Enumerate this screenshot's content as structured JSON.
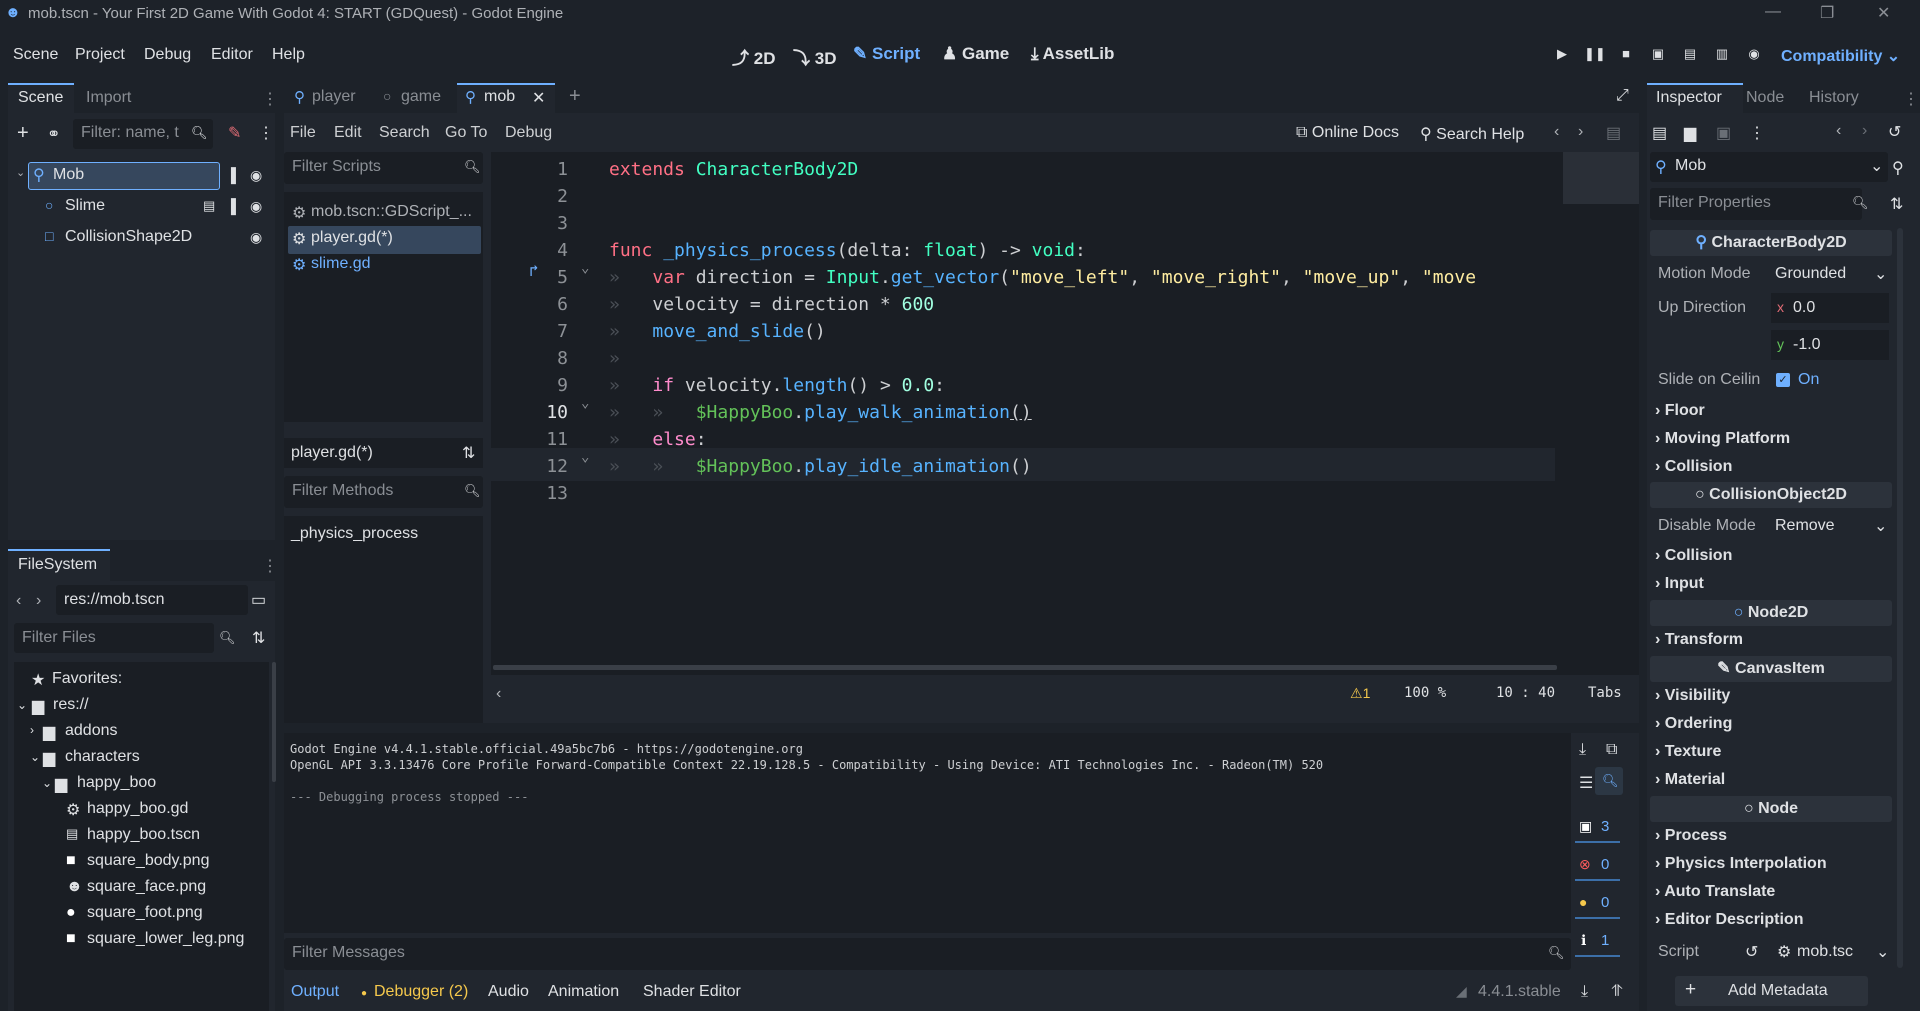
{
  "window": {
    "title": "mob.tscn - Your First 2D Game With Godot 4: START (GDQuest) - Godot Engine"
  },
  "menu": [
    "Scene",
    "Project",
    "Debug",
    "Editor",
    "Help"
  ],
  "workspaces": [
    {
      "label": "2D",
      "icon": "2d-icon"
    },
    {
      "label": "3D",
      "icon": "3d-icon"
    },
    {
      "label": "Script",
      "icon": "script-icon",
      "active": true
    },
    {
      "label": "Game",
      "icon": "game-icon"
    },
    {
      "label": "AssetLib",
      "icon": "assetlib-icon"
    }
  ],
  "renderer": "Compatibility",
  "scene_dock": {
    "tabs": [
      "Scene",
      "Import"
    ],
    "filter_placeholder": "Filter: name, t",
    "nodes": [
      "Mob",
      "Slime",
      "CollisionShape2D"
    ]
  },
  "filesystem": {
    "title": "FileSystem",
    "path": "res://mob.tscn",
    "filter_placeholder": "Filter Files",
    "items": [
      "Favorites:",
      "res://",
      "addons",
      "characters",
      "happy_boo",
      "happy_boo.gd",
      "happy_boo.tscn",
      "square_body.png",
      "square_face.png",
      "square_foot.png",
      "square_lower_leg.png"
    ]
  },
  "scene_tabs": [
    "player",
    "game",
    "mob"
  ],
  "script_menu": [
    "File",
    "Edit",
    "Search",
    "Go To",
    "Debug"
  ],
  "script_tools": {
    "online_docs": "Online Docs",
    "search_help": "Search Help"
  },
  "script_list": {
    "filter_placeholder": "Filter Scripts",
    "items": [
      "mob.tscn::GDScript_...",
      "player.gd(*)",
      "slime.gd"
    ],
    "current": "player.gd(*)",
    "methods_placeholder": "Filter Methods",
    "methods": [
      "_physics_process"
    ]
  },
  "code": {
    "line_numbers": [
      "1",
      "2",
      "3",
      "4",
      "5",
      "6",
      "7",
      "8",
      "9",
      "10",
      "11",
      "12",
      "13"
    ]
  },
  "status": {
    "warnings": "1",
    "zoom": "100 %",
    "line": "10",
    "col": "40",
    "indent": "Tabs"
  },
  "output": {
    "lines": [
      "Godot Engine v4.4.1.stable.official.49a5bc7b6 - https://godotengine.org",
      "OpenGL API 3.3.13476 Core Profile Forward-Compatible Context 22.19.128.5 - Compatibility - Using Device: ATI Technologies Inc. - Radeon(TM) 520",
      "",
      "--- Debugging process stopped ---"
    ],
    "filter_placeholder": "Filter Messages",
    "counts": {
      "messages": "3",
      "errors": "0",
      "warnings": "0",
      "info": "1"
    }
  },
  "bottom_tabs": [
    "Output",
    "Debugger (2)",
    "Audio",
    "Animation",
    "Shader Editor"
  ],
  "version": "4.4.1.stable",
  "inspector": {
    "tabs": [
      "Inspector",
      "Node",
      "History"
    ],
    "object": "Mob",
    "filter_placeholder": "Filter Properties",
    "class_char": "CharacterBody2D",
    "motion_mode_label": "Motion Mode",
    "motion_mode_value": "Grounded",
    "up_dir_label": "Up Direction",
    "up_x": "0.0",
    "up_y": "-1.0",
    "slide_label": "Slide on Ceilin",
    "slide_value": "On",
    "char_sections": [
      "Floor",
      "Moving Platform",
      "Collision"
    ],
    "class_coll": "CollisionObject2D",
    "disable_label": "Disable Mode",
    "disable_value": "Remove",
    "coll_sections": [
      "Collision",
      "Input"
    ],
    "class_node2d": "Node2D",
    "node2d_sections": [
      "Transform"
    ],
    "class_canvas": "CanvasItem",
    "canvas_sections": [
      "Visibility",
      "Ordering",
      "Texture",
      "Material"
    ],
    "class_node": "Node",
    "node_sections": [
      "Process",
      "Physics Interpolation",
      "Auto Translate",
      "Editor Description"
    ],
    "script_label": "Script",
    "script_value": "mob.tsc",
    "add_metadata": "Add Metadata"
  },
  "colors": {
    "accent": "#6fb0ff",
    "bg": "#1d2229",
    "panel": "#21262e",
    "keyword": "#ff7085",
    "type": "#42ffc2",
    "function": "#57b3ff",
    "string": "#ffeda1"
  }
}
